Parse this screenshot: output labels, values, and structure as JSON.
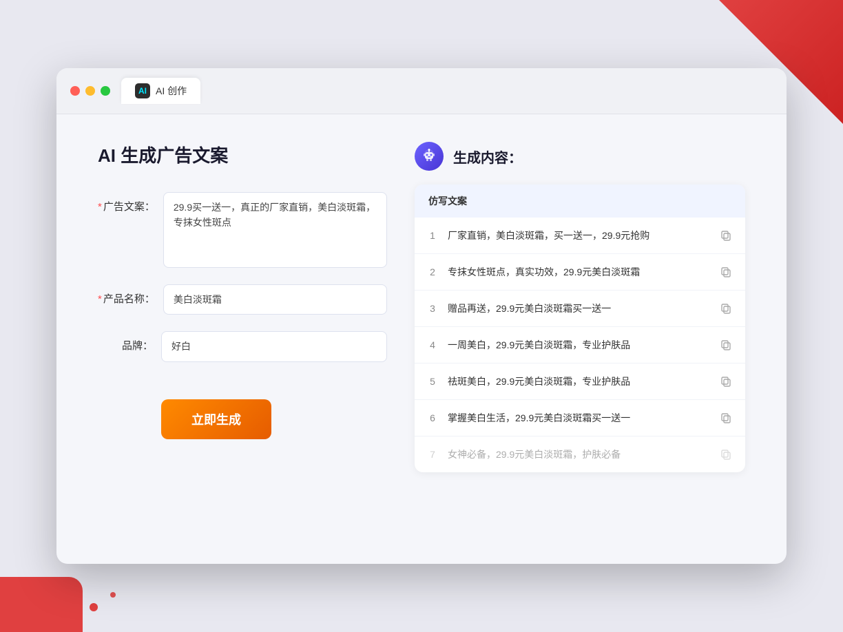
{
  "window": {
    "tab_label": "AI 创作",
    "tab_icon": "AI"
  },
  "left_panel": {
    "title": "AI 生成广告文案",
    "form": {
      "ad_copy_label": "广告文案：",
      "ad_copy_required": "*",
      "ad_copy_value": "29.9买一送一，真正的厂家直销，美白淡斑霜，专抹女性斑点",
      "product_name_label": "产品名称：",
      "product_name_required": "*",
      "product_name_value": "美白淡斑霜",
      "brand_label": "品牌：",
      "brand_value": "好白"
    },
    "generate_btn": "立即生成"
  },
  "right_panel": {
    "title": "生成内容：",
    "table_header": "仿写文案",
    "results": [
      {
        "num": "1",
        "text": "厂家直销，美白淡斑霜，买一送一，29.9元抢购",
        "faded": false
      },
      {
        "num": "2",
        "text": "专抹女性斑点，真实功效，29.9元美白淡斑霜",
        "faded": false
      },
      {
        "num": "3",
        "text": "赠品再送，29.9元美白淡斑霜买一送一",
        "faded": false
      },
      {
        "num": "4",
        "text": "一周美白，29.9元美白淡斑霜，专业护肤品",
        "faded": false
      },
      {
        "num": "5",
        "text": "祛斑美白，29.9元美白淡斑霜，专业护肤品",
        "faded": false
      },
      {
        "num": "6",
        "text": "掌握美白生活，29.9元美白淡斑霜买一送一",
        "faded": false
      },
      {
        "num": "7",
        "text": "女神必备，29.9元美白淡斑霜，护肤必备",
        "faded": true
      }
    ]
  },
  "colors": {
    "accent_orange": "#f06000",
    "accent_blue": "#4c6ef5",
    "required_red": "#ff4d4f"
  }
}
